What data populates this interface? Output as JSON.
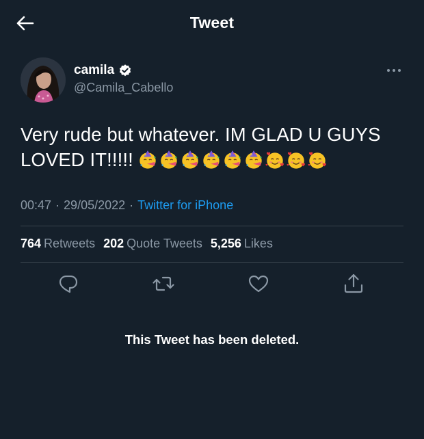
{
  "header": {
    "title": "Tweet",
    "back_icon": "arrow-left-icon"
  },
  "author": {
    "display_name": "camila",
    "handle": "@Camila_Cabello",
    "verified": true,
    "avatar_icon": "profile-photo"
  },
  "tweet": {
    "text": "Very rude but whatever. IM GLAD U GUYS LOVED IT!!!!!",
    "emojis": [
      "partying-face",
      "partying-face",
      "partying-face",
      "partying-face",
      "partying-face",
      "partying-face",
      "smiling-face-with-hearts",
      "smiling-face-with-hearts",
      "smiling-face-with-hearts"
    ]
  },
  "meta": {
    "time": "00:47",
    "date": "29/05/2022",
    "source": "Twitter for iPhone",
    "separator": "·"
  },
  "stats": [
    {
      "count": "764",
      "label": "Retweets"
    },
    {
      "count": "202",
      "label": "Quote Tweets"
    },
    {
      "count": "5,256",
      "label": "Likes"
    }
  ],
  "actions": [
    "reply-icon",
    "retweet-icon",
    "like-icon",
    "share-icon"
  ],
  "notice": "This Tweet has been deleted.",
  "colors": {
    "background": "#15202b",
    "text_primary": "#ffffff",
    "text_secondary": "#8b98a5",
    "link": "#1d9bf0",
    "divider": "#38444d"
  }
}
